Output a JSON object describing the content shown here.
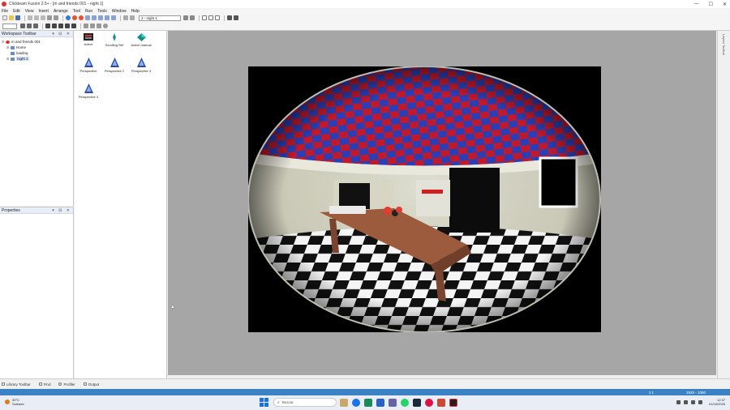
{
  "window": {
    "title": "Clickteam Fusion 2.5+ - [m and friends 001 - night 1]",
    "controls": [
      "—",
      "☐",
      "✕"
    ]
  },
  "menu": [
    "File",
    "Edit",
    "View",
    "Insert",
    "Arrange",
    "Tool",
    "Run",
    "Tools",
    "Window",
    "Help"
  ],
  "toolbar": {
    "view_select": "3 - night 1"
  },
  "workspace": {
    "header": "Workspace Toolbar",
    "tree": [
      {
        "label": "m and friends 001",
        "level": 0,
        "expander": "⊟"
      },
      {
        "label": "Home",
        "level": 1,
        "expander": "⊞"
      },
      {
        "label": "loading",
        "level": 1,
        "expander": ""
      },
      {
        "label": "night 1",
        "level": 1,
        "expander": "⊞",
        "selected": true
      }
    ]
  },
  "properties": {
    "header": "Properties"
  },
  "library": {
    "items": [
      {
        "label": "Active"
      },
      {
        "label": "Scrolling Ref"
      },
      {
        "label": "Active manual"
      },
      {
        "label": "Perspective"
      },
      {
        "label": "Perspective 2"
      },
      {
        "label": "Perspective 3"
      },
      {
        "label": "Perspective 4"
      }
    ]
  },
  "bottom_tabs": [
    "Library Toolbar",
    "Find",
    "Profiler",
    "Output"
  ],
  "statusbar": {
    "zoom": "1:1",
    "resolution": "1920 - 1080"
  },
  "taskbar": {
    "weather_temp": "30°C",
    "weather_desc": "Soleado",
    "search_placeholder": "Buscar",
    "time": "12:37",
    "date": "01/16/2026"
  },
  "colors": {
    "accent": "#3b82c4",
    "viewport_bg": "#a6a6a6",
    "checker_red": "#c0192b",
    "checker_blue": "#2a3fb5"
  }
}
